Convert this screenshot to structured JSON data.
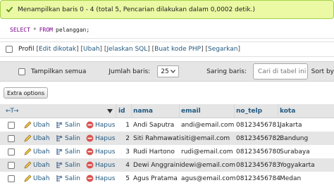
{
  "message": {
    "text": "Menampilkan baris 0 - 4 (total 5, Pencarian dilakukan dalam 0,0002 detik.)",
    "color": "#ebf8a4",
    "icon": "check-icon"
  },
  "sql": {
    "keyword_select": "SELECT",
    "star": "*",
    "keyword_from": "FROM",
    "table": "pelanggan;"
  },
  "profile": {
    "label": "Profil",
    "links": [
      "Edit dikotak",
      "Ubah",
      "Jelaskan SQL",
      "Buat kode PHP",
      "Segarkan"
    ]
  },
  "navigation": {
    "show_all_label": "Tampilkan semua",
    "rows_label": "Jumlah baris:",
    "rows_value": "25",
    "filter_label": "Saring baris:",
    "filter_placeholder": "Cari di tabel ini",
    "sort_label": "Sort by"
  },
  "extra_options": "Extra options",
  "table": {
    "columns": [
      "id",
      "nama",
      "email",
      "no_telp",
      "kota"
    ],
    "actions": {
      "edit": "Ubah",
      "copy": "Salin",
      "delete": "Hapus"
    },
    "rows": [
      {
        "id": "1",
        "nama": "Andi Saputra",
        "email": "andi@email.com",
        "no_telp": "08123456781",
        "kota": "Jakarta"
      },
      {
        "id": "2",
        "nama": "Siti Rahmawati",
        "email": "siti@email.com",
        "no_telp": "08123456782",
        "kota": "Bandung"
      },
      {
        "id": "3",
        "nama": "Rudi Hartono",
        "email": "rudi@email.com",
        "no_telp": "08123456780",
        "kota": "Surabaya"
      },
      {
        "id": "4",
        "nama": "Dewi Anggraini",
        "email": "dewi@email.com",
        "no_telp": "08123456783",
        "kota": "Yogyakarta"
      },
      {
        "id": "5",
        "nama": "Agus Pratama",
        "email": "agus@email.com",
        "no_telp": "08123456784",
        "kota": "Medan"
      }
    ]
  },
  "colors": {
    "link": "#235a81",
    "row_alt": "#e5e5e5",
    "success_border": "#a2d246"
  }
}
